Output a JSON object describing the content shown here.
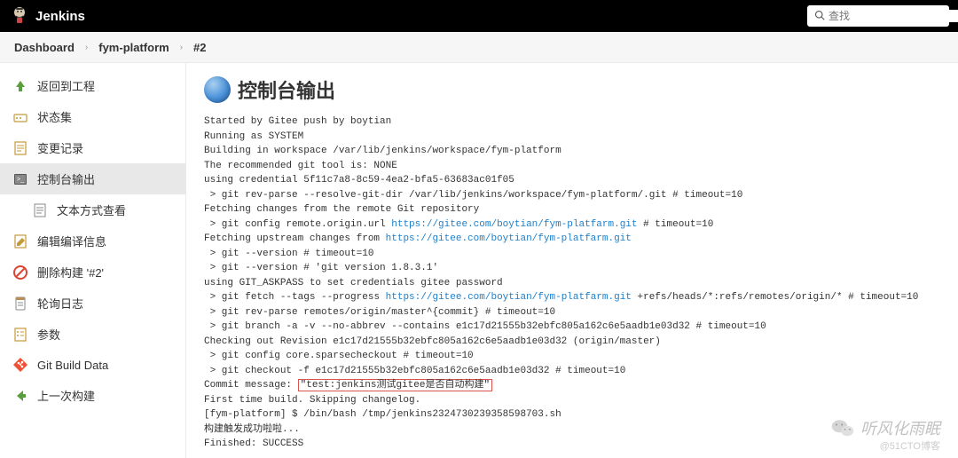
{
  "header": {
    "title": "Jenkins",
    "search_placeholder": "查找"
  },
  "breadcrumb": {
    "items": [
      "Dashboard",
      "fym-platform",
      "#2"
    ]
  },
  "sidebar": {
    "items": [
      {
        "label": "返回到工程",
        "icon": "arrow-up"
      },
      {
        "label": "状态集",
        "icon": "status"
      },
      {
        "label": "变更记录",
        "icon": "changes"
      },
      {
        "label": "控制台输出",
        "icon": "console",
        "active": true
      },
      {
        "label": "文本方式查看",
        "icon": "text",
        "sub": true
      },
      {
        "label": "编辑编译信息",
        "icon": "edit"
      },
      {
        "label": "删除构建 '#2'",
        "icon": "delete"
      },
      {
        "label": "轮询日志",
        "icon": "poll"
      },
      {
        "label": "参数",
        "icon": "params"
      },
      {
        "label": "Git Build Data",
        "icon": "git"
      },
      {
        "label": "上一次构建",
        "icon": "prev"
      }
    ]
  },
  "page": {
    "title": "控制台输出"
  },
  "console": {
    "lines": [
      {
        "t": "Started by Gitee push by boytian"
      },
      {
        "t": "Running as SYSTEM"
      },
      {
        "t": "Building in workspace /var/lib/jenkins/workspace/fym-platform"
      },
      {
        "t": "The recommended git tool is: NONE"
      },
      {
        "t": "using credential 5f11c7a8-8c59-4ea2-bfa5-63683ac01f05"
      },
      {
        "t": " > git rev-parse --resolve-git-dir /var/lib/jenkins/workspace/fym-platform/.git # timeout=10"
      },
      {
        "t": "Fetching changes from the remote Git repository"
      },
      {
        "pre": " > git config remote.origin.url ",
        "link": "https://gitee.com/boytian/fym-platfarm.git",
        "post": " # timeout=10"
      },
      {
        "pre": "Fetching upstream changes from ",
        "link": "https://gitee.com/boytian/fym-platfarm.git",
        "post": ""
      },
      {
        "t": " > git --version # timeout=10"
      },
      {
        "t": " > git --version # 'git version 1.8.3.1'"
      },
      {
        "t": "using GIT_ASKPASS to set credentials gitee password"
      },
      {
        "pre": " > git fetch --tags --progress ",
        "link": "https://gitee.com/boytian/fym-platfarm.git",
        "post": " +refs/heads/*:refs/remotes/origin/* # timeout=10"
      },
      {
        "t": " > git rev-parse remotes/origin/master^{commit} # timeout=10"
      },
      {
        "t": " > git branch -a -v --no-abbrev --contains e1c17d21555b32ebfc805a162c6e5aadb1e03d32 # timeout=10"
      },
      {
        "t": "Checking out Revision e1c17d21555b32ebfc805a162c6e5aadb1e03d32 (origin/master)"
      },
      {
        "t": " > git config core.sparsecheckout # timeout=10"
      },
      {
        "pre": " > git checkout -f ",
        "hash": "e1c17d21555b32ebfc805a162c6e5aadb1e03d32",
        "post": " # timeout=10"
      },
      {
        "pre": "Commit message: ",
        "boxed": "\"test:jenkins测试gitee是否自动构建\"",
        "post": ""
      },
      {
        "t": "First time build. Skipping changelog."
      },
      {
        "t": "[fym-platform] $ /bin/bash /tmp/jenkins2324730239358598703.sh"
      },
      {
        "t": "构建触发成功啦啦..."
      },
      {
        "t": "Finished: SUCCESS"
      }
    ]
  },
  "watermark": {
    "name": "听风化雨眠",
    "sub": "@51CTO博客"
  }
}
